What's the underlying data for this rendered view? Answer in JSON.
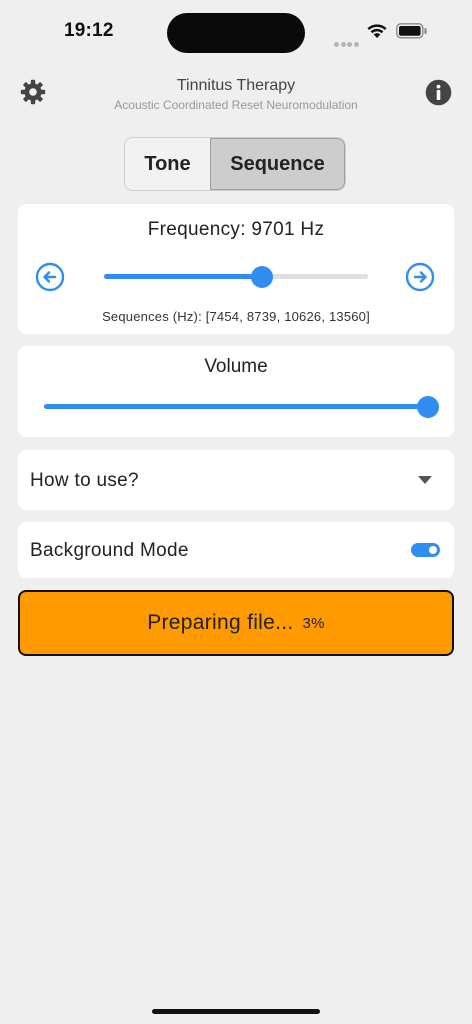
{
  "status_bar": {
    "time": "19:12"
  },
  "header": {
    "title": "Tinnitus Therapy",
    "subtitle": "Acoustic Coordinated Reset Neuromodulation",
    "settings_icon": "gear-icon",
    "info_icon": "info-icon"
  },
  "mode": {
    "options": [
      "Tone",
      "Sequence"
    ],
    "selected": "Sequence"
  },
  "frequency": {
    "label": "Frequency: 9701 Hz",
    "slider_fraction": 0.6,
    "sequences_text": "Sequences (Hz): [7454, 8739, 10626, 13560]",
    "prev_icon": "arrow-left-circle-icon",
    "next_icon": "arrow-right-circle-icon"
  },
  "volume": {
    "label": "Volume",
    "slider_fraction": 1.0
  },
  "how_to_use": {
    "label": "How to use?",
    "icon": "chevron-down-icon"
  },
  "background_mode": {
    "label": "Background Mode",
    "enabled": true
  },
  "prepare": {
    "label": "Preparing file...",
    "progress": "3%"
  },
  "colors": {
    "accent": "#2f8ef0",
    "button": "#ff9a00",
    "background": "#efefef"
  }
}
